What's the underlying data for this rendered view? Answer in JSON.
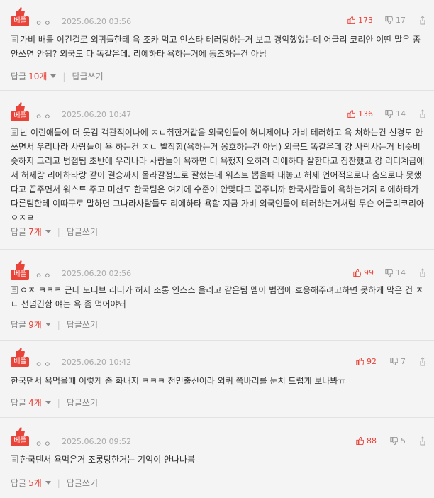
{
  "colors": {
    "accent": "#e8443a",
    "meta": "#aaaaaa",
    "border": "#e2e2e2",
    "background": "#f4f4f4"
  },
  "comments": [
    {
      "badge": "베플",
      "nick": "ㅇㅇ",
      "date": "2025.06.20 03:56",
      "up": "173",
      "down": "17",
      "text": "가비 배틀 이긴걸로 외퀴들한테 욕 조카 먹고 인스타 테러당하는거 보고 경악했었는데 어글리 코리안 이딴 말은 좀 안쓰면 안됨? 외국도 다 똑같은데. 리에하타 욕하는거에 동조하는건 아님",
      "reply_label": "답글",
      "reply_count": "10개",
      "write_reply": "답글쓰기"
    },
    {
      "badge": "베플",
      "nick": "ㅇㅇ",
      "date": "2025.06.20 10:47",
      "up": "136",
      "down": "14",
      "text": "난 이런애들이 더 웃김 객관적이나에 ㅈㄴ취한거같음 외국인들이 허니제이나 가비 테러하고 욕 처하는건 신경도 안쓰면서 우리나라 사람들이 욕 하는건 ㅈㄴ 발작함(욕하는거 옹호하는건 아님) 외국도 똑같은데 걍 사람사는거 비슷비슷하지 그리고 범접팀 초반에 우리나라 사람들이 욕하면 더 욕했지 오히려 리에하타 잘한다고 칭찬했고 걍 리더계급에서 허제랑 리에하타랑 같이 결승까지 올라갈정도로 잘했는데 워스트 뽑을때 대놓고 허제 언어적으로나 춤으로나 못했다고 꼽주면서 워스트 주고 미션도 한국팀은 여기에 수준이 안맞다고 꼽주니까 한국사람들이 욕하는거지 리에하타가 다른팀한테 이따구로 말하면 그나라사람들도 리에하타 욕함 지금 가비 외국인들이 테러하는거처럼 무슨 어글리코리아 ㅇㅈㄹ",
      "reply_label": "답글",
      "reply_count": "7개",
      "write_reply": "답글쓰기"
    },
    {
      "badge": "베플",
      "nick": "ㅇㅇ",
      "date": "2025.06.20 02:56",
      "up": "99",
      "down": "14",
      "text": "ㅇㅈ ㅋㅋㅋ 근데 모티브 리더가 허제 조롱 인스스 올리고 같은팀 멤이 범접에 호응해주려고하면 못하게 막은 건 ㅈㄴ 선넘긴함 얘는 욕 좀 먹어야돼",
      "reply_label": "답글",
      "reply_count": "9개",
      "write_reply": "답글쓰기"
    },
    {
      "badge": "베플",
      "nick": "ㅇㅇ",
      "date": "2025.06.20 10:42",
      "up": "92",
      "down": "7",
      "text": "한국댄서 욕먹을때 이렇게 좀 화내지 ㅋㅋㅋ 천민출신이라 외퀴 쪽바리를 눈치 드럽게 보나봐ㅠ",
      "reply_label": "답글",
      "reply_count": "4개",
      "write_reply": "답글쓰기"
    },
    {
      "badge": "베플",
      "nick": "ㅇㅇ",
      "date": "2025.06.20 09:52",
      "up": "88",
      "down": "5",
      "text": "한국댄서 욕먹은거 조롱당한거는 기억이 안나나봄",
      "reply_label": "답글",
      "reply_count": "5개",
      "write_reply": "답글쓰기"
    }
  ]
}
